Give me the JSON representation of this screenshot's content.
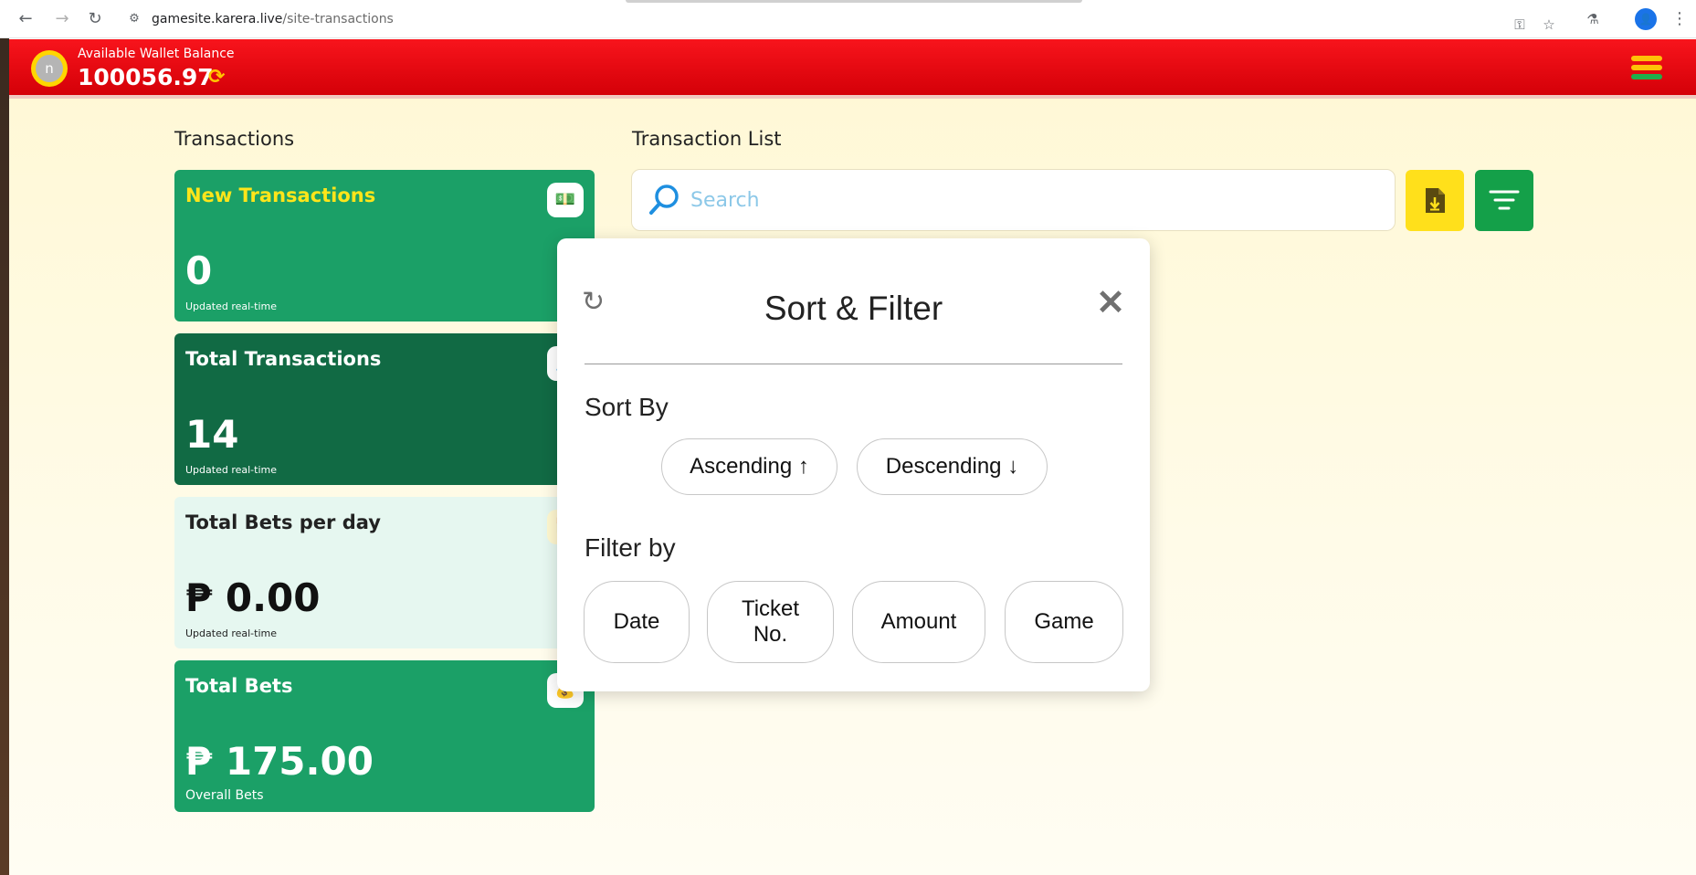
{
  "browser": {
    "url_domain": "gamesite.karera.live",
    "url_path": "/site-transactions",
    "profile_initial": "👤"
  },
  "header": {
    "avatar_initial": "n",
    "wallet_label": "Available Wallet Balance",
    "wallet_balance": "100056.97",
    "accent_color": "#e8000b"
  },
  "transactions": {
    "title": "Transactions",
    "cards": [
      {
        "title": "New Transactions",
        "value": "0",
        "subtitle": "Updated real-time",
        "icon": "hand-cash-icon"
      },
      {
        "title": "Total Transactions",
        "value": "14",
        "subtitle": "Updated real-time",
        "icon": "receipt-icon"
      },
      {
        "title": "Total Bets per day",
        "value": "₱ 0.00",
        "subtitle": "Updated real-time",
        "icon": "calendar-icon"
      },
      {
        "title": "Total Bets",
        "value": "₱ 175.00",
        "subtitle": "Overall Bets",
        "icon": "money-bag-icon"
      }
    ]
  },
  "transaction_list": {
    "title": "Transaction List",
    "search_placeholder": "Search"
  },
  "sort_filter": {
    "title": "Sort & Filter",
    "sort_label": "Sort By",
    "sort_options": [
      "Ascending ↑",
      "Descending ↓"
    ],
    "filter_label": "Filter by",
    "filter_options": [
      "Date",
      "Ticket No.",
      "Amount",
      "Game"
    ]
  }
}
